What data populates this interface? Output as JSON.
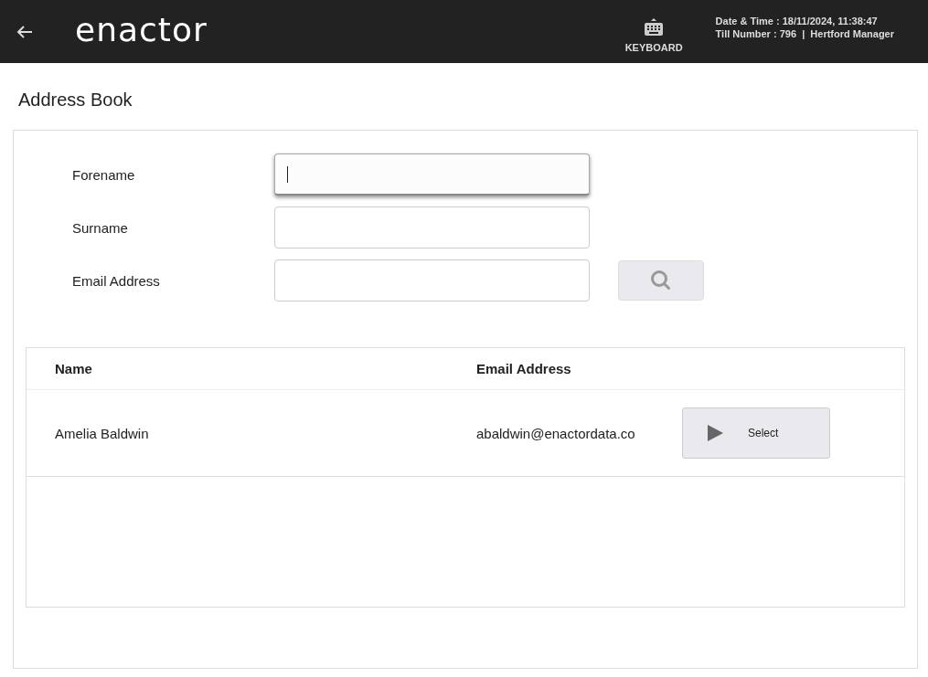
{
  "header": {
    "logo": "enactor",
    "keyboard_label": "KEYBOARD",
    "datetime": "Date & Time : 18/11/2024, 11:38:47",
    "till_info": "Till Number : 796  |  Hertford Manager"
  },
  "page_title": "Address Book",
  "form": {
    "fields": [
      {
        "label": "Forename",
        "focused": true
      },
      {
        "label": "Surname",
        "focused": false
      },
      {
        "label": "Email Address",
        "focused": false
      }
    ]
  },
  "table": {
    "columns": [
      "Name",
      "Email Address"
    ],
    "rows": [
      {
        "name": "Amelia Baldwin",
        "email": "abaldwin@enactordata.co",
        "button": "Select"
      }
    ]
  }
}
